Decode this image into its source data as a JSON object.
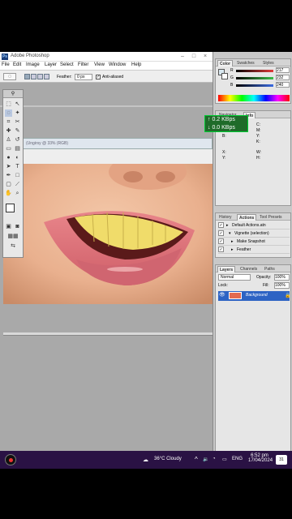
{
  "app": {
    "title": "Adobe Photoshop",
    "window_controls": [
      "–",
      "□",
      "×"
    ],
    "menu": [
      "File",
      "Edit",
      "Image",
      "Layer",
      "Select",
      "Filter",
      "View",
      "Window",
      "Help"
    ]
  },
  "options_bar": {
    "feather_label": "Feather:",
    "feather_value": "0 px",
    "anti_aliased_label": "Anti-aliased"
  },
  "document": {
    "title": "(Ungirsy @ 33% (RGB)"
  },
  "color_panel": {
    "tabs": [
      "Color",
      "Swatches",
      "Styles"
    ],
    "channels": [
      {
        "label": "R",
        "value": "217",
        "color": "#e23b3b"
      },
      {
        "label": "G",
        "value": "232",
        "color": "#3bbf4a"
      },
      {
        "label": "B",
        "value": "240",
        "color": "#3b6be2"
      }
    ]
  },
  "info_panel": {
    "tabs": [
      "Navigator",
      "Info"
    ],
    "labels": [
      "R:",
      "G:",
      "B:",
      "C:",
      "M:",
      "Y:",
      "K:"
    ],
    "sub": [
      "X:",
      "Y:",
      "W:",
      "H:"
    ]
  },
  "network_overlay": {
    "up": "↑ 0.2 KBps",
    "down": "↓ 0.0 KBps"
  },
  "history_panel": {
    "tabs": [
      "History",
      "Actions",
      "Tool Presets"
    ],
    "items": [
      {
        "label": "Default Actions.atn"
      },
      {
        "label": "Vignette (selection)"
      },
      {
        "label": "Make Snapshot"
      },
      {
        "label": "Feather"
      }
    ]
  },
  "layers_panel": {
    "tabs": [
      "Layers",
      "Channels",
      "Paths"
    ],
    "blend_mode": "Normal",
    "opacity_label": "Opacity:",
    "opacity_value": "100%",
    "lock_label": "Lock:",
    "fill_label": "Fill:",
    "fill_value": "100%",
    "layer_name": "Background"
  },
  "taskbar": {
    "weather": "36°C  Cloudy",
    "language": "ENG",
    "time": "6:52 pm",
    "date": "17/04/2024",
    "notification_count": "31"
  }
}
